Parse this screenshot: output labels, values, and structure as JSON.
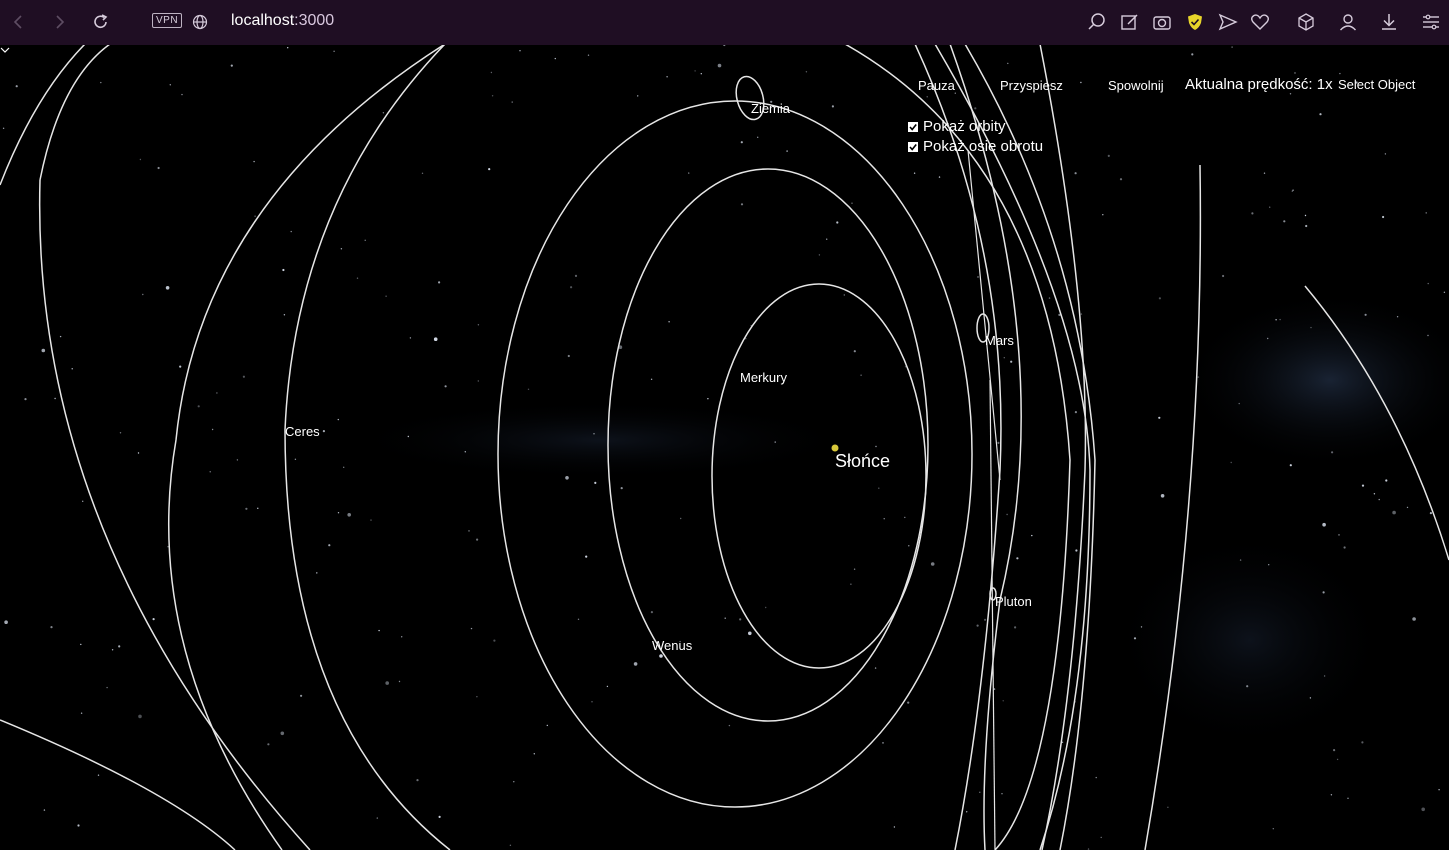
{
  "browser": {
    "vpn_label": "VPN",
    "url_host": "localhost",
    "url_port": ":3000",
    "icons": [
      "back-icon",
      "forward-icon",
      "reload-icon",
      "globe-icon",
      "search-icon",
      "edit-icon",
      "camera-icon",
      "shield-icon",
      "send-icon",
      "heart-icon",
      "cube-icon",
      "user-icon",
      "download-icon",
      "menu-icon"
    ]
  },
  "controls": {
    "pause_label": "Pauza",
    "speed_up_label": "Przyspiesz",
    "slow_down_label": "Spowolnij",
    "speed_text": "Aktualna prędkość: 1x",
    "select_value": "Select Object",
    "show_orbits_label": "Pokaż orbity",
    "show_axes_label": "Pokaż osie obrotu",
    "show_orbits_checked": true,
    "show_axes_checked": true
  },
  "scene": {
    "sun_label": "Słońce",
    "sun_color": "#d8c83a",
    "planets": [
      "Merkury",
      "Wenus",
      "Ziemia",
      "Mars",
      "Ceres",
      "Pluton"
    ]
  }
}
